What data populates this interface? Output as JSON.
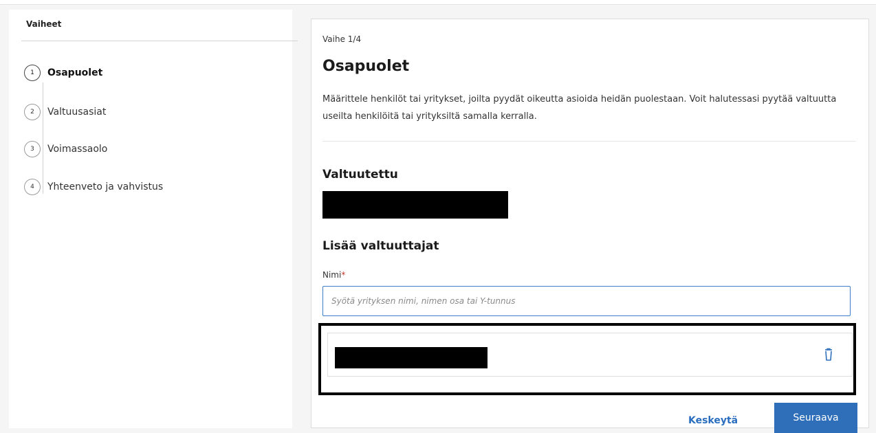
{
  "sidebar": {
    "title": "Vaiheet",
    "steps": [
      {
        "num": "1",
        "label": "Osapuolet"
      },
      {
        "num": "2",
        "label": "Valtuusasiat"
      },
      {
        "num": "3",
        "label": "Voimassaolo"
      },
      {
        "num": "4",
        "label": "Yhteenveto ja vahvistus"
      }
    ]
  },
  "main": {
    "phase": "Vaihe 1/4",
    "title": "Osapuolet",
    "description": "Määrittele henkilöt tai yritykset, joilta pyydät oikeutta asioida heidän puolestaan. Voit halutessasi pyytää valtuutta useilta henkilöitä tai yrityksiltä samalla kerralla.",
    "valtuutettu_heading": "Valtuutettu",
    "add_heading": "Lisää valtuuttajat",
    "name_label": "Nimi",
    "name_required_mark": "*",
    "search_placeholder": "Syötä yrityksen nimi, nimen osa tai Y-tunnus",
    "search_value": ""
  },
  "actions": {
    "cancel": "Keskeytä",
    "next": "Seuraava"
  },
  "colors": {
    "primary": "#2f6fba",
    "link": "#2a6ebf",
    "input_border": "#3c7fc8"
  },
  "icons": {
    "remove": "trash-icon"
  }
}
